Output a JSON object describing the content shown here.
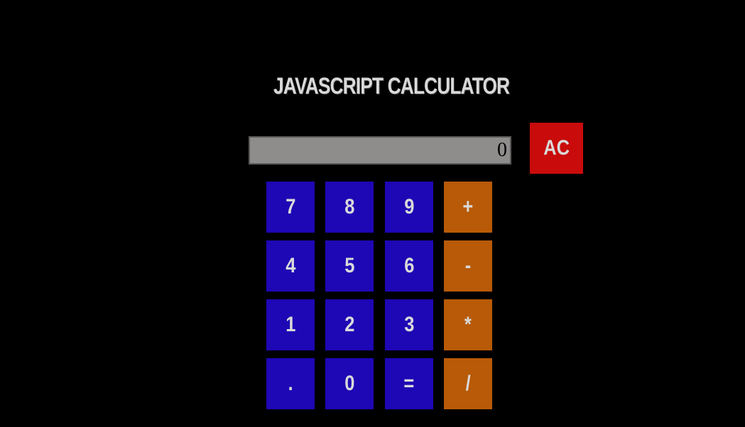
{
  "app": {
    "title": "JAVASCRIPT CALCULATOR"
  },
  "display": {
    "value": "0"
  },
  "clear": {
    "label": "AC"
  },
  "keys": {
    "row1": [
      "7",
      "8",
      "9",
      "+"
    ],
    "row2": [
      "4",
      "5",
      "6",
      "-"
    ],
    "row3": [
      "1",
      "2",
      "3",
      "*"
    ],
    "row4": [
      ".",
      "0",
      "=",
      "/"
    ]
  },
  "colors": {
    "background": "#000000",
    "number_key": "#1e07b5",
    "operator_key": "#b85a07",
    "clear_key": "#c90b0b",
    "display_bg": "#8f8c8c",
    "key_text": "#d9d9d9"
  }
}
